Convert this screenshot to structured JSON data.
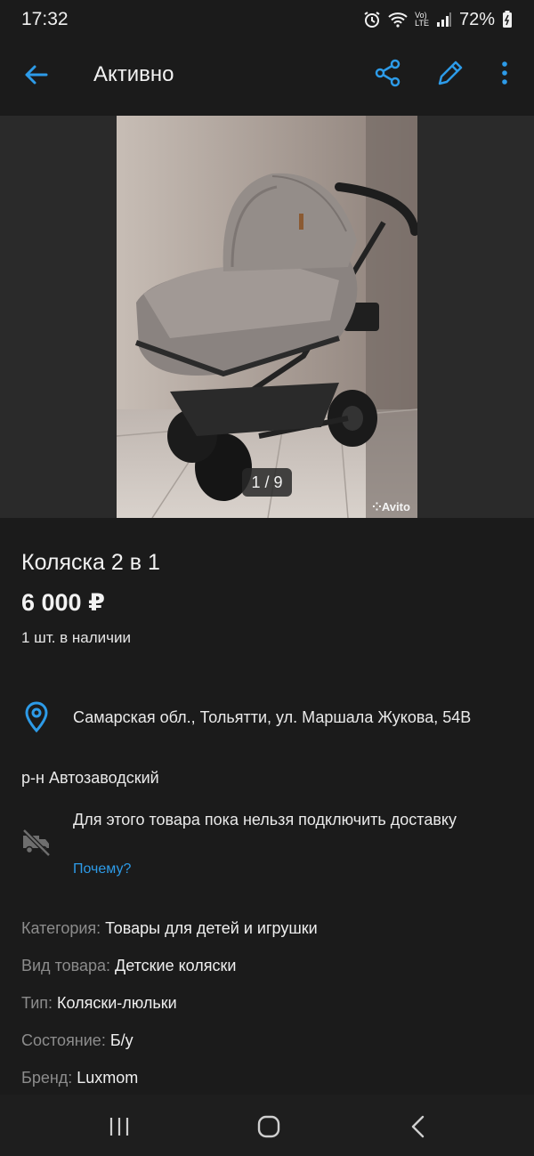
{
  "status_bar": {
    "time": "17:32",
    "battery_percent": "72%",
    "icons": [
      "alarm-icon",
      "wifi-icon",
      "volte-icon",
      "signal-icon",
      "battery-icon"
    ],
    "volte_label_top": "Vo)",
    "volte_label_bottom": "LTE"
  },
  "app_bar": {
    "title": "Активно",
    "icons": [
      "back-arrow-icon",
      "share-icon",
      "edit-icon",
      "more-vertical-icon"
    ],
    "accent_color": "#2d9be8"
  },
  "gallery": {
    "counter": "1 / 9",
    "watermark": "Avito"
  },
  "listing": {
    "title": "Коляска 2 в 1",
    "price": "6 000 ₽",
    "stock": "1 шт. в наличии",
    "address": "Самарская обл., Тольятти, ул. Маршала Жукова, 54В",
    "district": "р-н Автозаводский",
    "delivery_text": "Для этого товара пока нельзя подключить доставку",
    "delivery_link": "Почему?"
  },
  "properties": [
    {
      "key": "Категория:",
      "value": "Товары для детей и игрушки"
    },
    {
      "key": "Вид товара:",
      "value": "Детские коляски"
    },
    {
      "key": "Тип:",
      "value": "Коляски-люльки"
    },
    {
      "key": "Состояние:",
      "value": "Б/у"
    },
    {
      "key": "Бренд:",
      "value": "Luxmom"
    }
  ],
  "nav_bar": {
    "icons": [
      "recents-icon",
      "home-icon",
      "back-icon"
    ]
  }
}
